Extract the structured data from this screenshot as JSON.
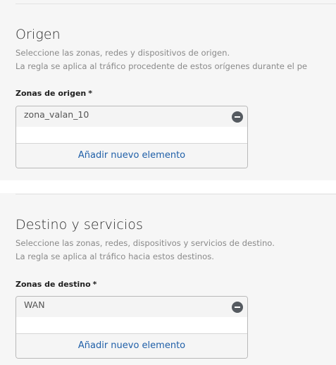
{
  "origin": {
    "title": "Origen",
    "description_line1": "Seleccione las zonas, redes y dispositivos de origen.",
    "description_line2": "La regla se aplica al tráfico procedente de estos orígenes durante el pe",
    "field_label": "Zonas de origen",
    "required_mark": "*",
    "items": [
      {
        "label": "zona_valan_10",
        "icon": "remove-circle-icon"
      }
    ],
    "add_label": "Añadir nuevo elemento"
  },
  "destination": {
    "title": "Destino y servicios",
    "description_line1": "Seleccione las zonas, redes, dispositivos y servicios de destino.",
    "description_line2": "La regla se aplica al tráfico hacia estos destinos.",
    "field_label": "Zonas de destino",
    "required_mark": "*",
    "items": [
      {
        "label": "WAN",
        "icon": "remove-circle-icon"
      }
    ],
    "add_label": "Añadir nuevo elemento"
  },
  "colors": {
    "accent_link": "#1f5fa8",
    "panel_bg": "#f6f6f6",
    "remove_icon": "#555a60"
  }
}
